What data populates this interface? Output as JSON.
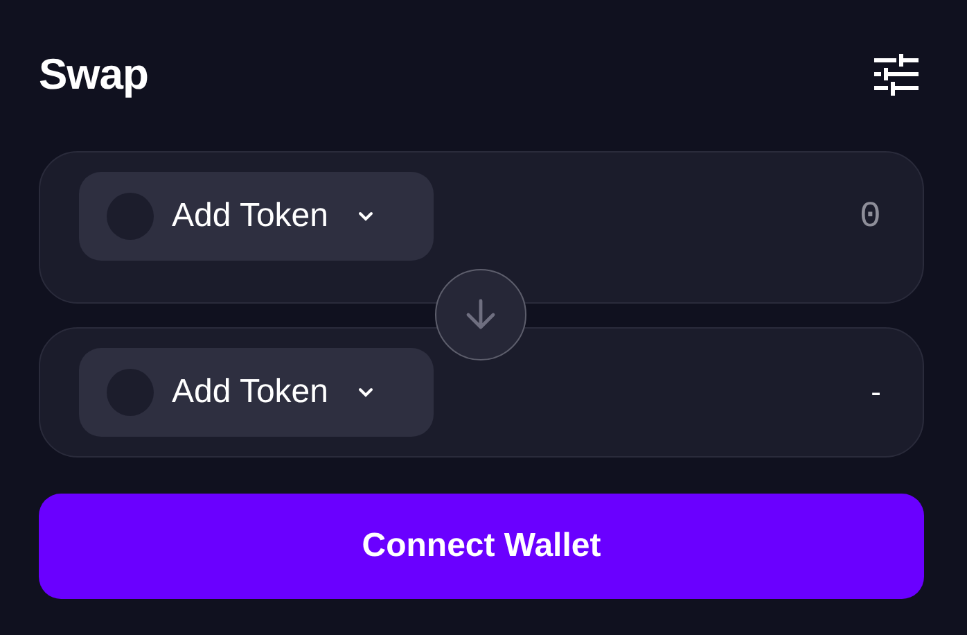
{
  "title": "Swap",
  "panels": [
    {
      "token_label": "Add Token",
      "amount": {
        "kind": "input",
        "placeholder": "0"
      }
    },
    {
      "token_label": "Add Token",
      "amount": {
        "kind": "text",
        "text": "-"
      }
    }
  ],
  "connect_button": "Connect Wallet"
}
